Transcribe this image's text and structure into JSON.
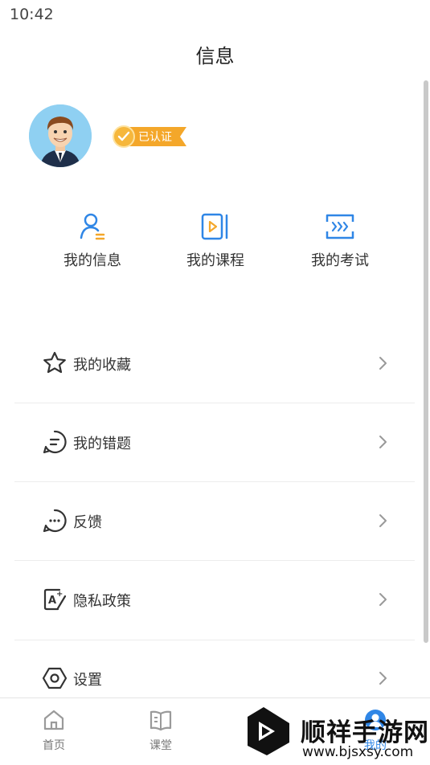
{
  "status_bar": {
    "time": "10:42"
  },
  "header": {
    "title": "信息"
  },
  "profile": {
    "badge": "已认证"
  },
  "quick_actions": [
    {
      "label": "我的信息",
      "icon": "user-info-icon"
    },
    {
      "label": "我的课程",
      "icon": "course-video-icon"
    },
    {
      "label": "我的考试",
      "icon": "exam-icon"
    }
  ],
  "menu": [
    {
      "label": "我的收藏",
      "icon": "star-icon"
    },
    {
      "label": "我的错题",
      "icon": "chat-bubble-icon"
    },
    {
      "label": "反馈",
      "icon": "feedback-icon"
    },
    {
      "label": "隐私政策",
      "icon": "privacy-edit-icon"
    },
    {
      "label": "设置",
      "icon": "settings-hexagon-icon"
    }
  ],
  "tabs": [
    {
      "label": "首页",
      "icon": "home-icon"
    },
    {
      "label": "课堂",
      "icon": "book-icon"
    },
    {
      "label": "我的",
      "icon": "profile-icon"
    }
  ],
  "watermark": {
    "title": "顺祥手游网",
    "url": "www.bjsxsy.com"
  },
  "colors": {
    "accent": "#2f86e6",
    "badge": "#f4a72a",
    "text": "#333333"
  }
}
